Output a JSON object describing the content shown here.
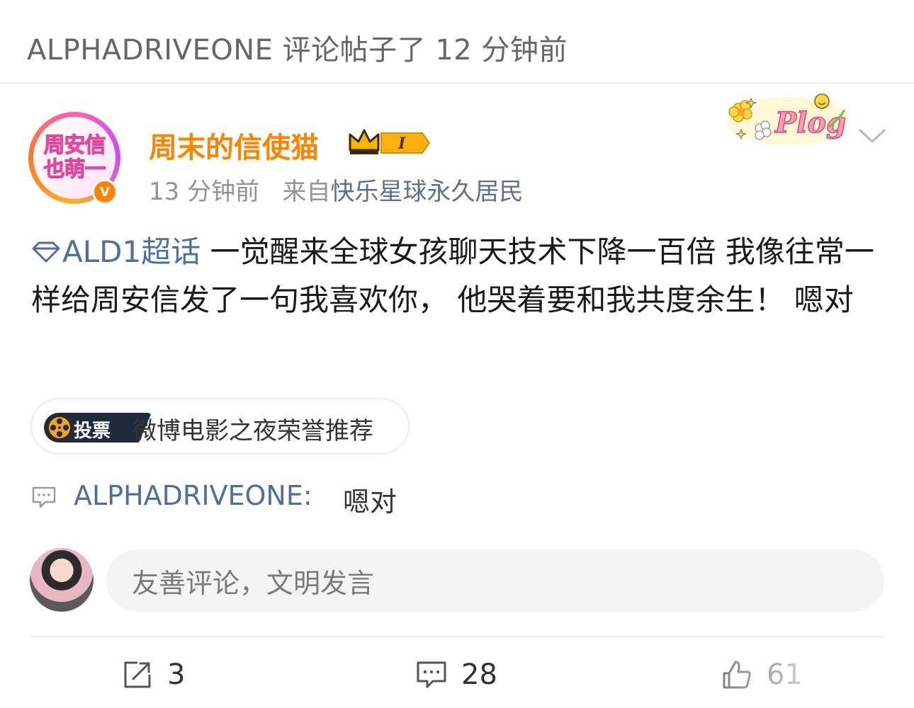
{
  "notice": {
    "text": "ALPHADRIVEONE 评论帖子了 12 分钟前"
  },
  "post": {
    "author": {
      "name": "周末的信使猫",
      "avatar_text_line1": "周安信",
      "avatar_text_line2": "也萌一",
      "verified_mark": "V",
      "rank_badge": "I"
    },
    "time": "13 分钟前",
    "source_prefix": "来自",
    "source": "快乐星球永久居民",
    "topic_tag": "ALD1超话",
    "content": " 一觉醒来全球女孩聊天技术下降一百倍 我像往常一样给周安信发了一句我喜欢你， 他哭着要和我共度余生！ 嗯对",
    "vote": {
      "badge_label": "投票",
      "title": "微博电影之夜荣誉推荐"
    },
    "reply": {
      "author": "ALPHADRIVEONE:",
      "text": "嗯对"
    },
    "comment_input": {
      "placeholder": "友善评论，文明发言"
    },
    "actions": {
      "repost_count": "3",
      "comment_count": "28",
      "like_count": "61"
    }
  },
  "colors": {
    "username": "#ff8200",
    "link": "#4e6ea3",
    "meta": "#939393"
  }
}
